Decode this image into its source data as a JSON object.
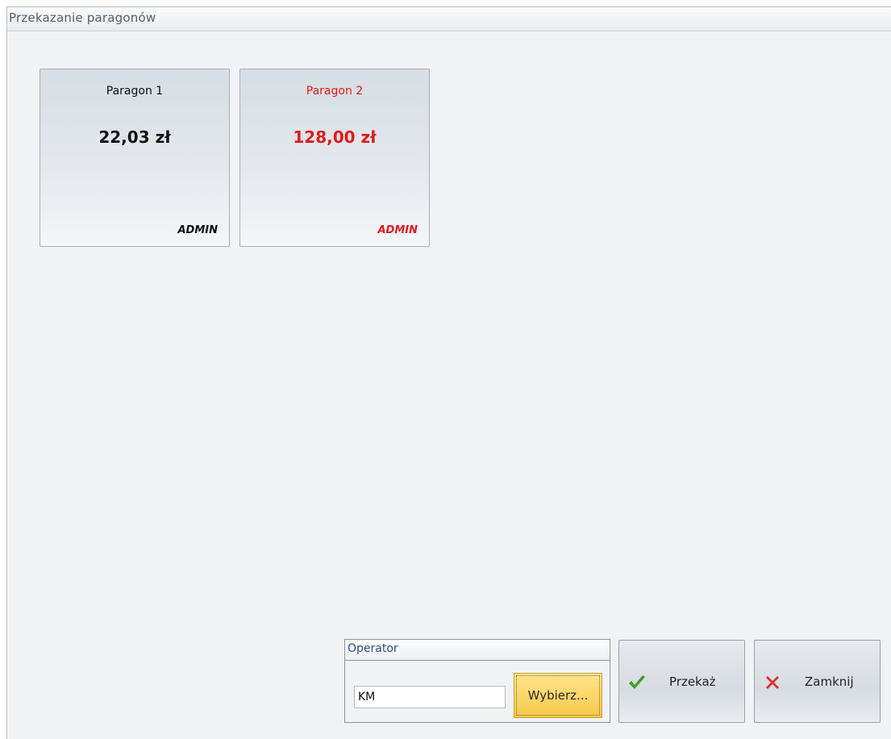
{
  "window": {
    "title": "Przekazanie paragonów"
  },
  "receipts": [
    {
      "name": "Paragon 1",
      "amount": "22,03 zł",
      "user": "ADMIN",
      "color": "#111111"
    },
    {
      "name": "Paragon 2",
      "amount": "128,00 zł",
      "user": "ADMIN",
      "color": "#e21b1b"
    }
  ],
  "operator": {
    "label": "Operator",
    "value": "KM",
    "choose_label": "Wybierz..."
  },
  "actions": {
    "transfer": {
      "label": "Przekaż",
      "icon": "checkmark-icon",
      "icon_color": "#3ea02a"
    },
    "close": {
      "label": "Zamknij",
      "icon": "close-x-icon",
      "icon_color": "#d93030"
    }
  }
}
